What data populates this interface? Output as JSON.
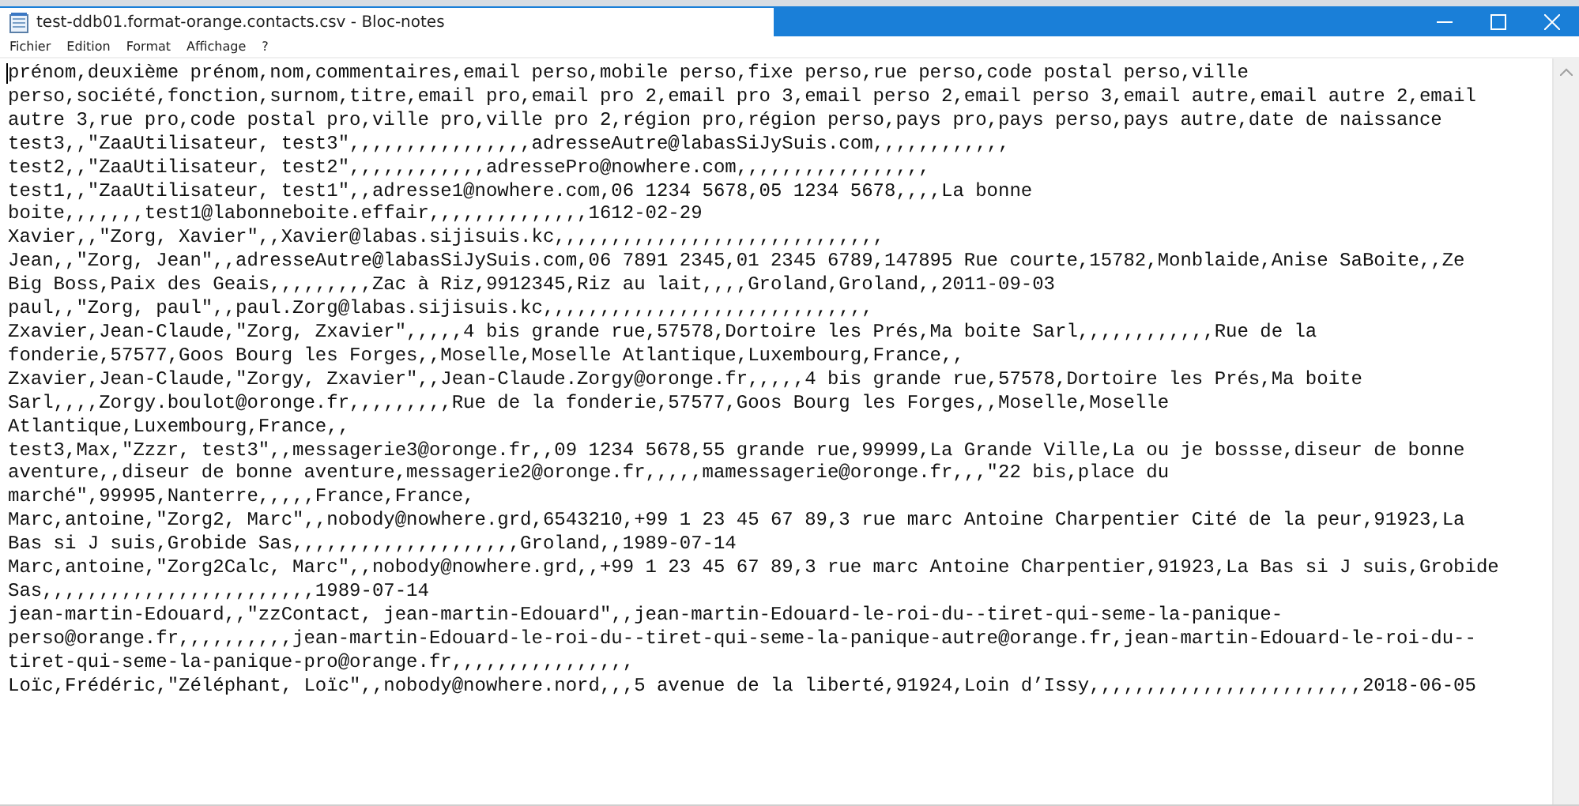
{
  "window": {
    "title": "test-ddb01.format-orange.contacts.csv - Bloc-notes"
  },
  "menu": [
    "Fichier",
    "Edition",
    "Format",
    "Affichage",
    "?"
  ],
  "lines": [
    "prénom,deuxième prénom,nom,commentaires,email perso,mobile perso,fixe perso,rue perso,code postal perso,ville",
    "perso,société,fonction,surnom,titre,email pro,email pro 2,email pro 3,email perso 2,email perso 3,email autre,email autre 2,email",
    "autre 3,rue pro,code postal pro,ville pro,ville pro 2,région pro,région perso,pays pro,pays perso,pays autre,date de naissance",
    "test3,,\"ZaaUtilisateur, test3\",,,,,,,,,,,,,,,,adresseAutre@labasSiJySuis.com,,,,,,,,,,,,",
    "test2,,\"ZaaUtilisateur, test2\",,,,,,,,,,,,adressePro@nowhere.com,,,,,,,,,,,,,,,,,",
    "test1,,\"ZaaUtilisateur, test1\",,adresse1@nowhere.com,06 1234 5678,05 1234 5678,,,,La bonne",
    "boite,,,,,,,test1@labonneboite.effair,,,,,,,,,,,,,,1612-02-29",
    "Xavier,,\"Zorg, Xavier\",,Xavier@labas.sijisuis.kc,,,,,,,,,,,,,,,,,,,,,,,,,,,,,",
    "Jean,,\"Zorg, Jean\",,adresseAutre@labasSiJySuis.com,06 7891 2345,01 2345 6789,147895 Rue courte,15782,Monblaide,Anise SaBoite,,Ze",
    "Big Boss,Paix des Geais,,,,,,,,,Zac à Riz,9912345,Riz au lait,,,,Groland,Groland,,2011-09-03",
    "paul,,\"Zorg, paul\",,paul.Zorg@labas.sijisuis.kc,,,,,,,,,,,,,,,,,,,,,,,,,,,,,",
    "Zxavier,Jean-Claude,\"Zorg, Zxavier\",,,,,4 bis grande rue,57578,Dortoire les Prés,Ma boite Sarl,,,,,,,,,,,,Rue de la",
    "fonderie,57577,Goos Bourg les Forges,,Moselle,Moselle Atlantique,Luxembourg,France,,",
    "Zxavier,Jean-Claude,\"Zorgy, Zxavier\",,Jean-Claude.Zorgy@oronge.fr,,,,,4 bis grande rue,57578,Dortoire les Prés,Ma boite",
    "Sarl,,,,Zorgy.boulot@oronge.fr,,,,,,,,,Rue de la fonderie,57577,Goos Bourg les Forges,,Moselle,Moselle",
    "Atlantique,Luxembourg,France,,",
    "test3,Max,\"Zzzr, test3\",,messagerie3@oronge.fr,,09 1234 5678,55 grande rue,99999,La Grande Ville,La ou je bossse,diseur de bonne",
    "aventure,,diseur de bonne aventure,messagerie2@oronge.fr,,,,,mamessagerie@oronge.fr,,,\"22 bis,place du",
    "marché\",99995,Nanterre,,,,,France,France,",
    "Marc,antoine,\"Zorg2, Marc\",,nobody@nowhere.grd,6543210,+99 1 23 45 67 89,3 rue marc Antoine Charpentier Cité de la peur,91923,La",
    "Bas si J suis,Grobide Sas,,,,,,,,,,,,,,,,,,,,Groland,,1989-07-14",
    "Marc,antoine,\"Zorg2Calc, Marc\",,nobody@nowhere.grd,,+99 1 23 45 67 89,3 rue marc Antoine Charpentier,91923,La Bas si J suis,Grobide",
    "Sas,,,,,,,,,,,,,,,,,,,,,,,,1989-07-14",
    "jean-martin-Edouard,,\"zzContact, jean-martin-Edouard\",,jean-martin-Edouard-le-roi-du--tiret-qui-seme-la-panique-",
    "perso@orange.fr,,,,,,,,,,jean-martin-Edouard-le-roi-du--tiret-qui-seme-la-panique-autre@orange.fr,jean-martin-Edouard-le-roi-du--",
    "tiret-qui-seme-la-panique-pro@orange.fr,,,,,,,,,,,,,,,,",
    "Loïc,Frédéric,\"Zéléphant, Loïc\",,nobody@nowhere.nord,,,5 avenue de la liberté,91924,Loin d’Issy,,,,,,,,,,,,,,,,,,,,,,,,2018-06-05"
  ]
}
